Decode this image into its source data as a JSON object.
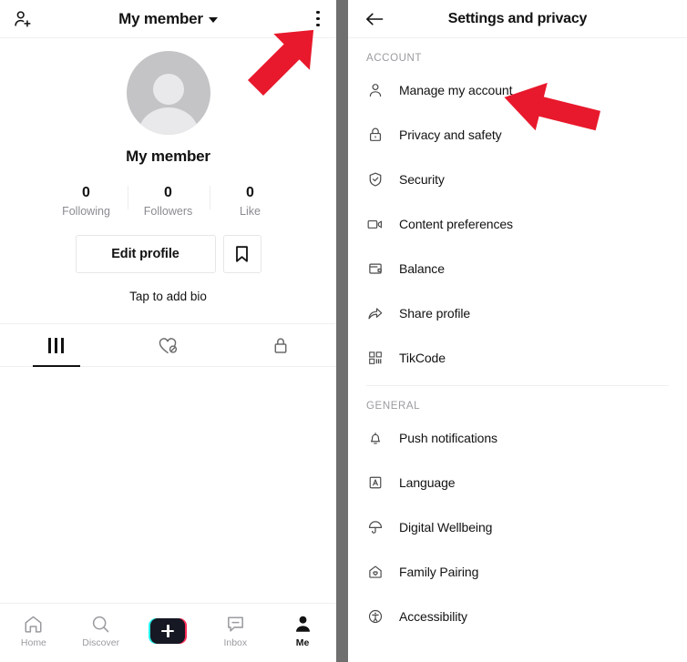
{
  "profile": {
    "header": {
      "add_friend_icon": "add-person-icon",
      "title": "My member",
      "dropdown_icon": "caret-down-icon",
      "more_icon": "three-dots-vertical-icon"
    },
    "avatar_icon": "default-avatar-icon",
    "username": "My member",
    "stats": [
      {
        "num": "0",
        "label": "Following"
      },
      {
        "num": "0",
        "label": "Followers"
      },
      {
        "num": "0",
        "label": "Like"
      }
    ],
    "edit_button": "Edit profile",
    "bookmark_icon": "bookmark-icon",
    "bio": "Tap to add bio",
    "tabs": [
      {
        "icon": "posts-grid-icon",
        "active": true
      },
      {
        "icon": "heart-slash-icon",
        "active": false
      },
      {
        "icon": "lock-icon",
        "active": false
      }
    ],
    "bottom_nav": [
      {
        "label": "Home",
        "icon": "home-icon",
        "active": false
      },
      {
        "label": "Discover",
        "icon": "search-icon",
        "active": false
      },
      {
        "label": "",
        "icon": "create-plus-icon",
        "active": false
      },
      {
        "label": "Inbox",
        "icon": "inbox-message-icon",
        "active": false
      },
      {
        "label": "Me",
        "icon": "person-icon",
        "active": true
      }
    ]
  },
  "settings": {
    "header": {
      "back_icon": "back-arrow-icon",
      "title": "Settings and privacy"
    },
    "sections": [
      {
        "title": "ACCOUNT",
        "items": [
          {
            "label": "Manage my account",
            "icon": "person-icon"
          },
          {
            "label": "Privacy and safety",
            "icon": "lock-icon"
          },
          {
            "label": "Security",
            "icon": "shield-check-icon"
          },
          {
            "label": "Content preferences",
            "icon": "video-camera-icon"
          },
          {
            "label": "Balance",
            "icon": "wallet-icon"
          },
          {
            "label": "Share profile",
            "icon": "share-arrow-icon"
          },
          {
            "label": "TikCode",
            "icon": "qr-code-icon"
          }
        ]
      },
      {
        "title": "GENERAL",
        "items": [
          {
            "label": "Push notifications",
            "icon": "bell-icon"
          },
          {
            "label": "Language",
            "icon": "language-a-icon"
          },
          {
            "label": "Digital Wellbeing",
            "icon": "umbrella-icon"
          },
          {
            "label": "Family Pairing",
            "icon": "house-heart-icon"
          },
          {
            "label": "Accessibility",
            "icon": "accessibility-icon"
          }
        ]
      }
    ]
  },
  "annotations": {
    "arrows": [
      {
        "name": "arrow-to-more-menu",
        "direction": "up-right",
        "color": "#E8192C"
      },
      {
        "name": "arrow-to-manage-my-account",
        "direction": "left",
        "color": "#E8192C"
      }
    ],
    "watermark": {
      "name": "site-watermark",
      "color": "#F57C20"
    }
  },
  "colors": {
    "accent_cyan": "#25F4EE",
    "accent_pink": "#FE2C55",
    "text_primary": "#121212",
    "text_muted": "#8a8b91",
    "divider_bar": "#6f6f6f",
    "arrow_red": "#E8192C",
    "watermark_orange": "#F57C20"
  }
}
